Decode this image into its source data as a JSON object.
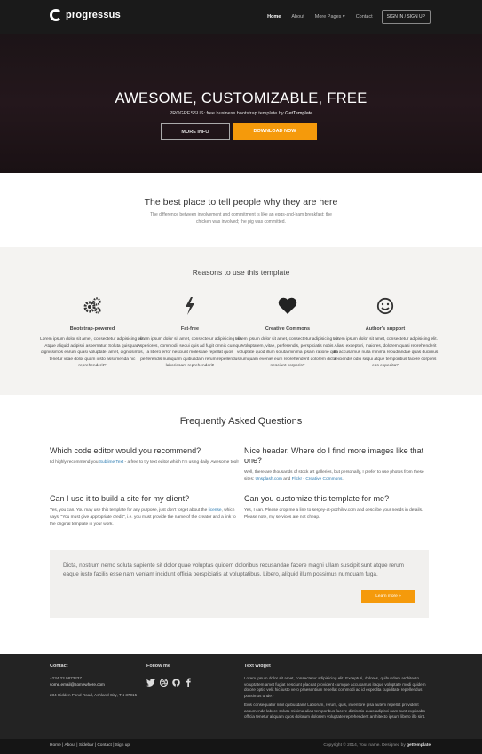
{
  "brand": {
    "name": "progressus"
  },
  "nav": {
    "home": "Home",
    "about": "About",
    "more": "More Pages ▾",
    "contact": "Contact",
    "sign": "SIGN IN / SIGN UP"
  },
  "hero": {
    "title": "AWESOME, CUSTOMIZABLE, FREE",
    "subtitle_prefix": "PROGRESSUS: free business bootstrap template by ",
    "subtitle_link": "GetTemplate",
    "more_btn": "MORE INFO",
    "download_btn": "DOWNLOAD NOW"
  },
  "intro": {
    "title": "The best place to tell people why they are here",
    "text": "The difference between involvement and commitment is like an eggs-and-ham breakfast: the chicken was involved; the pig was committed."
  },
  "reasons": {
    "title": "Reasons to use this template",
    "features": [
      {
        "icon": "gears-icon",
        "title": "Bootstrap-powered",
        "text": "Lorem ipsum dolor sit amet, consectetur adipisicing elit. Atque aliquid adipisci aspernatur. Soluta quisquam dignissimos earum quasi voluptate, amet, dignissimos, tenetur vitae dolor quam iusto assumenda hic reprehenderit?"
      },
      {
        "icon": "flash-icon",
        "title": "Fat-free",
        "text": "Lorem ipsum dolor sit amet, consectetur adipisicing elit. Asperiores, commodi, sequi quis ad fugit omnis cumque a libero error nesciunt molestiae repellat quos perferendis numquam quibusdam rerum repellendus laboriosam reprehenderit!"
      },
      {
        "icon": "heart-icon",
        "title": "Creative Commons",
        "text": "Lorem ipsum dolor sit amet, consectetur adipisicing elit. Voluptatem, vitae, perferendis, perspiciatis nobis voluptate quod illum soluta minima ipsam ratione quia numquam eveniet eum reprehenderit dolorem dicta nesciunt corporis?"
      },
      {
        "icon": "smile-icon",
        "title": "Author's support",
        "text": "Lorem ipsum dolor sit amet, consectetur adipisicing elit. Alias, excepturi, maiores, dolorem quasi reprehenderit illo accusamus nulla minima repudiandae quas ducimus reiciendis odio sequi atque temporibus facere corporis eos expedita?"
      }
    ]
  },
  "faq": {
    "title": "Frequently Asked Questions",
    "items": [
      {
        "q": "Which code editor would you recommend?",
        "a_pre": "I'd highly recommend you ",
        "a_link": "Sublime Text",
        "a_post": " - a free to try text editor which I'm using daily. Awesome tool!"
      },
      {
        "q": "Nice header. Where do I find more images like that one?",
        "a_pre": "Well, there are thousands of stock art galleries, but personally, I prefer to use photos from these sites: ",
        "a_link": "Unsplash.com",
        "a_mid": " and ",
        "a_link2": "Flickr - Creative Commons",
        "a_post": "."
      },
      {
        "q": "Can I use it to build a site for my client?",
        "a_pre": "Yes, you can. You may use this template for any purpose, just don't forget about the ",
        "a_link": "license",
        "a_post": ", which says: \"You must give appropriate credit\", i.e. you must provide the name of the creator and a link to the original template in your work."
      },
      {
        "q": "Can you customize this template for me?",
        "a_pre": "Yes, I can. Please drop me a line to sergey-at-pozhilov.com and describe your needs in details. Please note, my services are not cheap.",
        "a_link": "",
        "a_post": ""
      }
    ]
  },
  "quote": {
    "text": "Dicta, nostrum nemo soluta sapiente sit dolor quae voluptas quidem doloribus recusandae facere magni ullam suscipit sunt atque rerum eaque iusto facilis esse nam veniam incidunt officia perspiciatis at voluptatibus. Libero, aliquid illum possimus numquam fuga.",
    "button": "Learn more »"
  },
  "footer": {
    "contact_title": "Contact",
    "phone": "+234 23 9873237",
    "email": "some.email@somewhere.com",
    "address": "234 Hidden Pond Road, Ashland City, TN 37015",
    "follow_title": "Follow me",
    "social": [
      "twitter-icon",
      "dribbble-icon",
      "github-icon",
      "facebook-icon"
    ],
    "widget_title": "Text widget",
    "widget_p1": "Lorem ipsum dolor sit amet, consectetur adipisicing elit. Excepturi, dolores, quibusdam architecto voluptatem amet fugiat nesciunt placeat provident cumque accusamus itaque voluptate modi quidem dolore optio velit hic iusto vero praesentium repellat commodi ad id expedita cupiditate repellendus possimus unde?",
    "widget_p2": "Eius consequatur nihil quibusdam! Laborum, rerum, quis, inventore ipsa autem repellat provident assumenda labore soluta minima alias temporibus facere distinctio quas adipisci nam sunt explicabo officia tenetur aliquam quos dolorum dolorem voluptate reprehenderit architecto ipsum libero illo sint.",
    "links": "Home | About | Sidebar | Contact | Sign up",
    "copyright_pre": "Copyright © 2014, Your name. Designed by ",
    "copyright_link": "gettemplate"
  }
}
